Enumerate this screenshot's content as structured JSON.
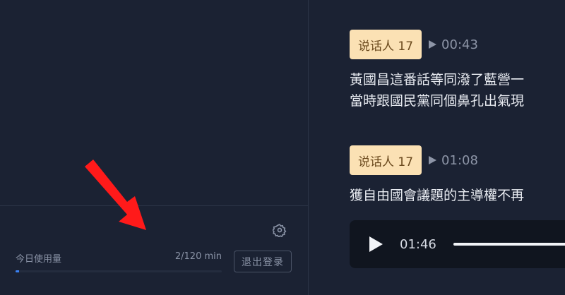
{
  "left_panel": {
    "footer": {
      "settings_icon": "gear-icon",
      "usage_label": "今日使用量",
      "usage_value": "2/120 min",
      "usage_progress_fraction": 0.0167,
      "logout_label": "退出登录"
    },
    "annotation": {
      "icon": "red-arrow",
      "color": "#ff0000"
    }
  },
  "transcript": {
    "segments": [
      {
        "speaker": "说话人 17",
        "time": "00:43",
        "lines": [
          "黃國昌這番話等同潑了藍營一",
          "當時跟國民黨同個鼻孔出氣現"
        ]
      },
      {
        "speaker": "说话人 17",
        "time": "01:08",
        "lines": [
          "獲自由國會議題的主導權不再"
        ]
      }
    ],
    "player": {
      "current_time": "01:46"
    }
  },
  "colors": {
    "background": "#1b2233",
    "speaker_tag_bg": "#fbe1b4",
    "speaker_tag_text": "#6b4a1e",
    "accent_progress": "#3b82f6",
    "player_bg": "#10151f"
  }
}
